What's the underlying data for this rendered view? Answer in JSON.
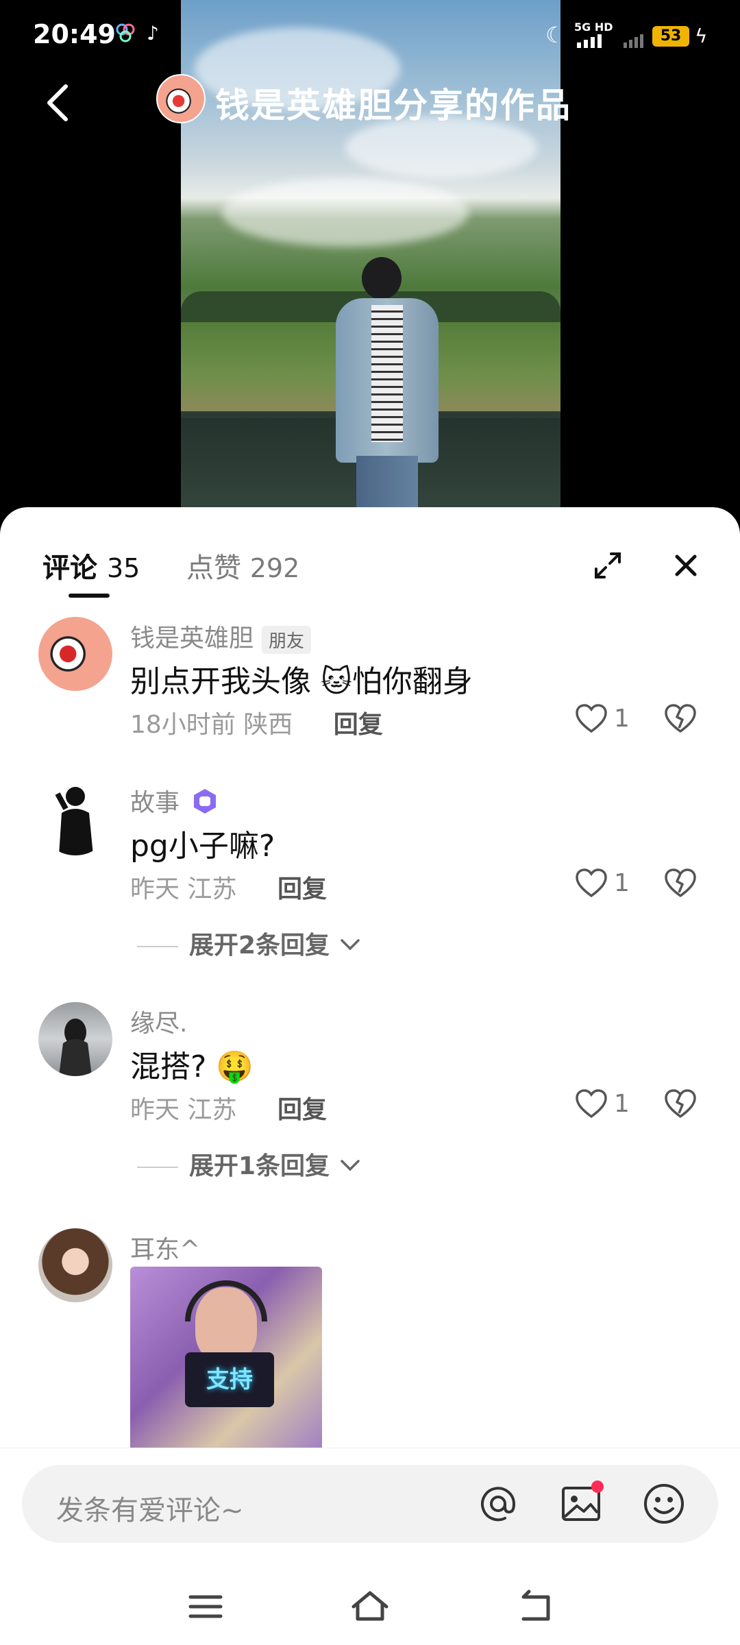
{
  "status_bar": {
    "time": "20:49",
    "network": "5G HD",
    "battery": "53"
  },
  "header": {
    "title": "钱是英雄胆分享的作品"
  },
  "tabs": [
    {
      "label": "评论",
      "count": "35",
      "active": true
    },
    {
      "label": "点赞",
      "count": "292",
      "active": false
    }
  ],
  "comments": [
    {
      "name": "钱是英雄胆",
      "badge": "朋友",
      "text": "别点开我头像 🐱怕你翻身",
      "time": "18小时前",
      "location": "陕西",
      "reply_label": "回复",
      "likes": "1"
    },
    {
      "name": "故事",
      "badge": "",
      "text": "pg小子嘛?",
      "time": "昨天",
      "location": "江苏",
      "reply_label": "回复",
      "likes": "1",
      "expand": "展开2条回复"
    },
    {
      "name": "缘尽.",
      "badge": "",
      "text": "混搭? 🤑",
      "time": "昨天",
      "location": "江苏",
      "reply_label": "回复",
      "likes": "1",
      "expand": "展开1条回复"
    },
    {
      "name": "耳东^",
      "sticker_text": "支持"
    }
  ],
  "input": {
    "placeholder": "发条有爱评论~"
  },
  "icons": [
    "back-icon",
    "expand-icon",
    "close-icon",
    "heart-icon",
    "dislike-heart-icon",
    "at-icon",
    "image-icon",
    "emoji-icon",
    "menu-icon",
    "home-icon",
    "back-nav-icon"
  ],
  "colors": {
    "red_dot": "#ff2d55",
    "badge_purple": "#8b6cf0"
  }
}
